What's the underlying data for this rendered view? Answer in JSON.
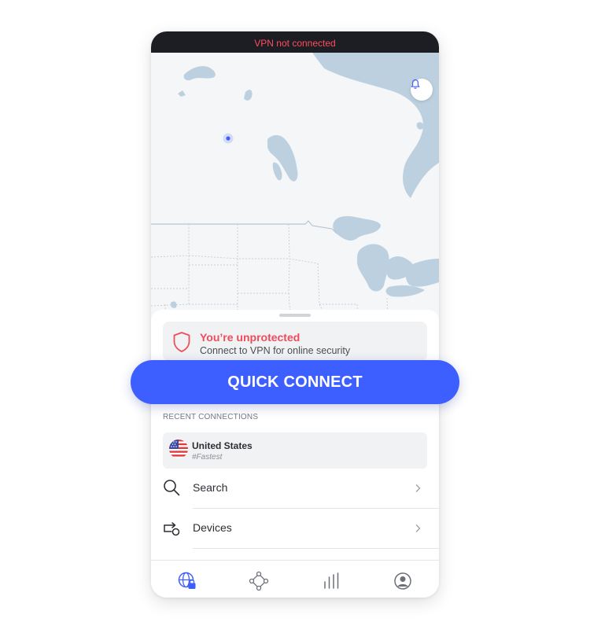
{
  "status_bar": {
    "text": "VPN not connected"
  },
  "map": {
    "bell_icon": "bell-icon"
  },
  "status_card": {
    "title": "You’re unprotected",
    "subtitle": "Connect to VPN for online security",
    "icon": "shield-icon",
    "accent": "#ef4c5b"
  },
  "quick_connect": {
    "label": "QUICK CONNECT",
    "color": "#3e5fff"
  },
  "recent": {
    "header": "RECENT CONNECTIONS",
    "items": [
      {
        "name": "United States",
        "sub": "#Fastest",
        "icon": "us-flag-icon"
      }
    ]
  },
  "menu": [
    {
      "label": "Search",
      "icon": "search-icon"
    },
    {
      "label": "Devices",
      "icon": "devices-icon"
    }
  ],
  "tabs": [
    {
      "name": "vpn-globe-tab",
      "icon": "globe-lock-icon",
      "active": true
    },
    {
      "name": "meshnet-tab",
      "icon": "meshnet-icon",
      "active": false
    },
    {
      "name": "stats-tab",
      "icon": "stats-bars-icon",
      "active": false
    },
    {
      "name": "profile-tab",
      "icon": "profile-icon",
      "active": false
    }
  ]
}
